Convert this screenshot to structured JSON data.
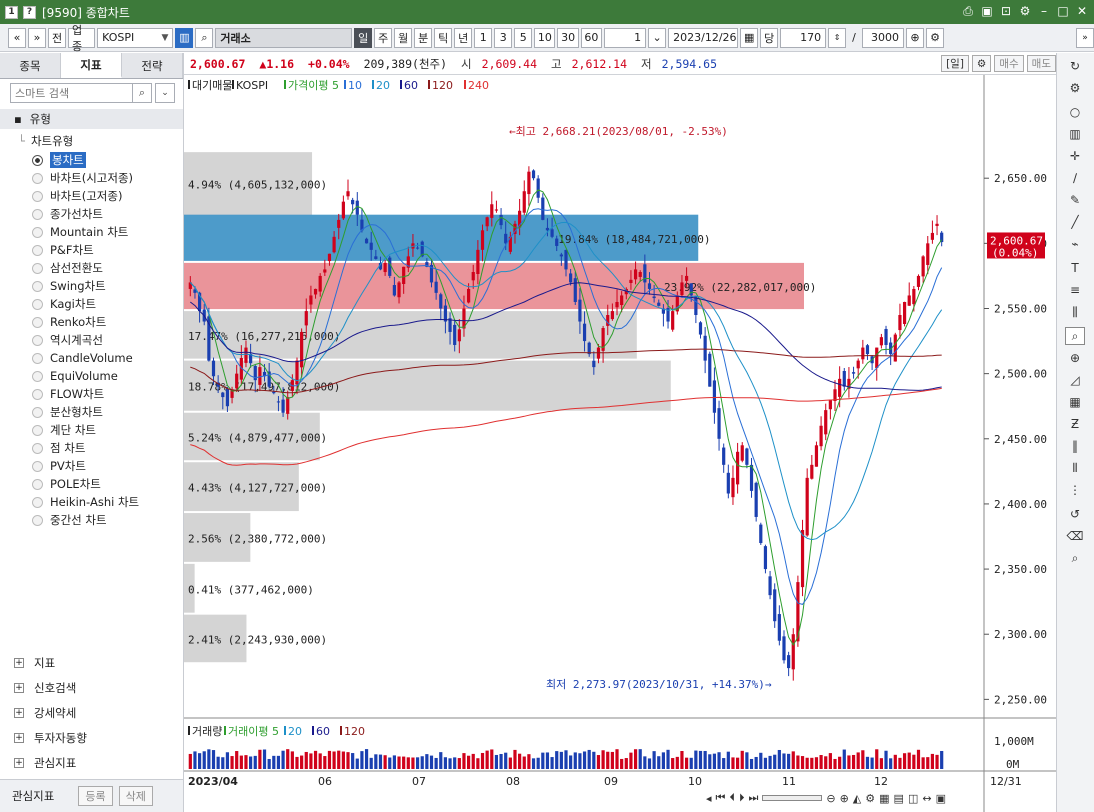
{
  "window": {
    "title": "[9590] 종합차트",
    "icon1": "1",
    "icon2": "?"
  },
  "toolbar": {
    "nav_back": "«",
    "nav_down": "»",
    "prev_label": "전",
    "sector_label": "업종",
    "index_code": "KOSPI",
    "exchange": "거래소",
    "periods": [
      "일",
      "주",
      "월",
      "분",
      "틱",
      "년"
    ],
    "minutes": [
      "1",
      "3",
      "5",
      "10",
      "30",
      "60"
    ],
    "interval_value": "1",
    "date": "2023/12/26",
    "unit_label": "당",
    "count": "170",
    "count_sep": "/",
    "max_count": "3000",
    "collapse": "»"
  },
  "quote": {
    "price": "2,600.67",
    "change": "▲1.16",
    "pct": "+0.04%",
    "volume": "209,389(천주)",
    "open_lbl": "시",
    "open": "2,609.44",
    "high_lbl": "고",
    "high": "2,612.14",
    "low_lbl": "저",
    "low": "2,594.65",
    "period_btn": "[일]",
    "buy_btn": "매수",
    "sell_btn": "매도"
  },
  "left": {
    "tabs": [
      "종목",
      "지표",
      "전략"
    ],
    "search_placeholder": "스마트 검색",
    "group_label": "유형",
    "tree_root": "차트유형",
    "chart_types": [
      "봉차트",
      "바차트(시고저종)",
      "바차트(고저종)",
      "종가선차트",
      "Mountain 차트",
      "P&F차트",
      "삼선전환도",
      "Swing차트",
      "Kagi차트",
      "Renko차트",
      "역시계곡선",
      "CandleVolume",
      "EquiVolume",
      "FLOW차트",
      "분산형차트",
      "계단 차트",
      "점 차트",
      "PV차트",
      "POLE차트",
      "Heikin-Ashi 차트",
      "중간선 차트"
    ],
    "accordions": [
      "지표",
      "신호검색",
      "강세약세",
      "투자자동향",
      "관심지표"
    ],
    "bottom_label": "관심지표",
    "register": "등록",
    "delete": "삭제"
  },
  "legend": {
    "items": [
      {
        "text": "대기매물",
        "color": "#222222"
      },
      {
        "text": "KOSPI",
        "color": "#222222"
      },
      {
        "text": "가격이평 5",
        "color": "#2e9e2e"
      },
      {
        "text": "10",
        "color": "#2a6fd6"
      },
      {
        "text": "20",
        "color": "#1e90c8"
      },
      {
        "text": "60",
        "color": "#1a1a8c"
      },
      {
        "text": "120",
        "color": "#8b1a1a"
      },
      {
        "text": "240",
        "color": "#e03030"
      }
    ]
  },
  "vol_legend": {
    "items": [
      {
        "text": "거래량",
        "color": "#222222"
      },
      {
        "text": "거래이평 5",
        "color": "#2e9e2e"
      },
      {
        "text": "20",
        "color": "#1e90c8"
      },
      {
        "text": "60",
        "color": "#1a1a8c"
      },
      {
        "text": "120",
        "color": "#8b1a1a"
      }
    ]
  },
  "chart_data": {
    "type": "candlestick",
    "x_ticks": [
      "2023/04",
      "06",
      "07",
      "08",
      "09",
      "10",
      "11",
      "12",
      "12/31"
    ],
    "y_ticks": [
      2650,
      2600,
      2550,
      2500,
      2450,
      2400,
      2350,
      2300,
      2250
    ],
    "ylim": [
      2238,
      2720
    ],
    "current_label": "2,600.67",
    "current_pct": "(0.04%)",
    "vol_ticks": [
      "1,000M",
      "0M"
    ],
    "annotations": {
      "high": "←최고 2,668.21(2023/08/01, -2.53%)",
      "low": "최저 2,273.97(2023/10/31, +14.37%)→"
    },
    "volume_profile": [
      {
        "label": "4.94% (4,605,132,000)",
        "lo": 2620,
        "hi": 2670,
        "pct": 4.94
      },
      {
        "label": "19.84% (18,484,721,000)",
        "lo": 2585,
        "hi": 2622,
        "pct": 19.84
      },
      {
        "label": "23.92% (22,282,017,000)",
        "lo": 2548,
        "hi": 2585,
        "pct": 23.92
      },
      {
        "label": "17.47% (16,277,216,000)",
        "lo": 2510,
        "hi": 2548,
        "pct": 17.47
      },
      {
        "label": "18.78% (17,497,812,000)",
        "lo": 2470,
        "hi": 2510,
        "pct": 18.78
      },
      {
        "label": "5.24% (4,879,477,000)",
        "lo": 2432,
        "hi": 2470,
        "pct": 5.24
      },
      {
        "label": "4.43% (4,127,727,000)",
        "lo": 2393,
        "hi": 2432,
        "pct": 4.43
      },
      {
        "label": "2.56% (2,380,772,000)",
        "lo": 2354,
        "hi": 2393,
        "pct": 2.56
      },
      {
        "label": "0.41% (377,462,000)",
        "lo": 2315,
        "hi": 2354,
        "pct": 0.41
      },
      {
        "label": "2.41% (2,243,930,000)",
        "lo": 2277,
        "hi": 2315,
        "pct": 2.41
      }
    ],
    "closes": [
      2570,
      2562,
      2548,
      2540,
      2510,
      2498,
      2490,
      2482,
      2475,
      2488,
      2500,
      2512,
      2520,
      2508,
      2495,
      2505,
      2498,
      2490,
      2485,
      2478,
      2470,
      2482,
      2495,
      2510,
      2532,
      2548,
      2560,
      2565,
      2575,
      2580,
      2592,
      2605,
      2618,
      2632,
      2640,
      2630,
      2622,
      2610,
      2600,
      2595,
      2588,
      2580,
      2585,
      2575,
      2560,
      2570,
      2582,
      2590,
      2600,
      2596,
      2590,
      2582,
      2570,
      2562,
      2550,
      2540,
      2532,
      2522,
      2534,
      2550,
      2565,
      2578,
      2595,
      2610,
      2620,
      2630,
      2626,
      2614,
      2600,
      2605,
      2615,
      2625,
      2640,
      2655,
      2650,
      2635,
      2618,
      2610,
      2605,
      2598,
      2590,
      2580,
      2570,
      2555,
      2540,
      2525,
      2515,
      2505,
      2520,
      2535,
      2545,
      2548,
      2555,
      2560,
      2565,
      2572,
      2580,
      2578,
      2570,
      2565,
      2558,
      2552,
      2546,
      2540,
      2548,
      2560,
      2570,
      2575,
      2560,
      2545,
      2530,
      2510,
      2490,
      2470,
      2450,
      2430,
      2408,
      2420,
      2440,
      2445,
      2430,
      2410,
      2390,
      2370,
      2350,
      2330,
      2310,
      2295,
      2280,
      2274,
      2300,
      2340,
      2380,
      2420,
      2430,
      2445,
      2460,
      2472,
      2480,
      2488,
      2496,
      2490,
      2496,
      2500,
      2510,
      2520,
      2515,
      2508,
      2520,
      2528,
      2522,
      2515,
      2530,
      2545,
      2555,
      2560,
      2565,
      2575,
      2590,
      2600,
      2608,
      2615,
      2601
    ],
    "series": [
      {
        "name": "5",
        "color": "#2e9e2e"
      },
      {
        "name": "10",
        "color": "#2a6fd6"
      },
      {
        "name": "20",
        "color": "#1e90c8"
      },
      {
        "name": "60",
        "color": "#1a1a8c"
      },
      {
        "name": "120",
        "color": "#8b1a1a"
      },
      {
        "name": "240",
        "color": "#e03030"
      }
    ]
  }
}
